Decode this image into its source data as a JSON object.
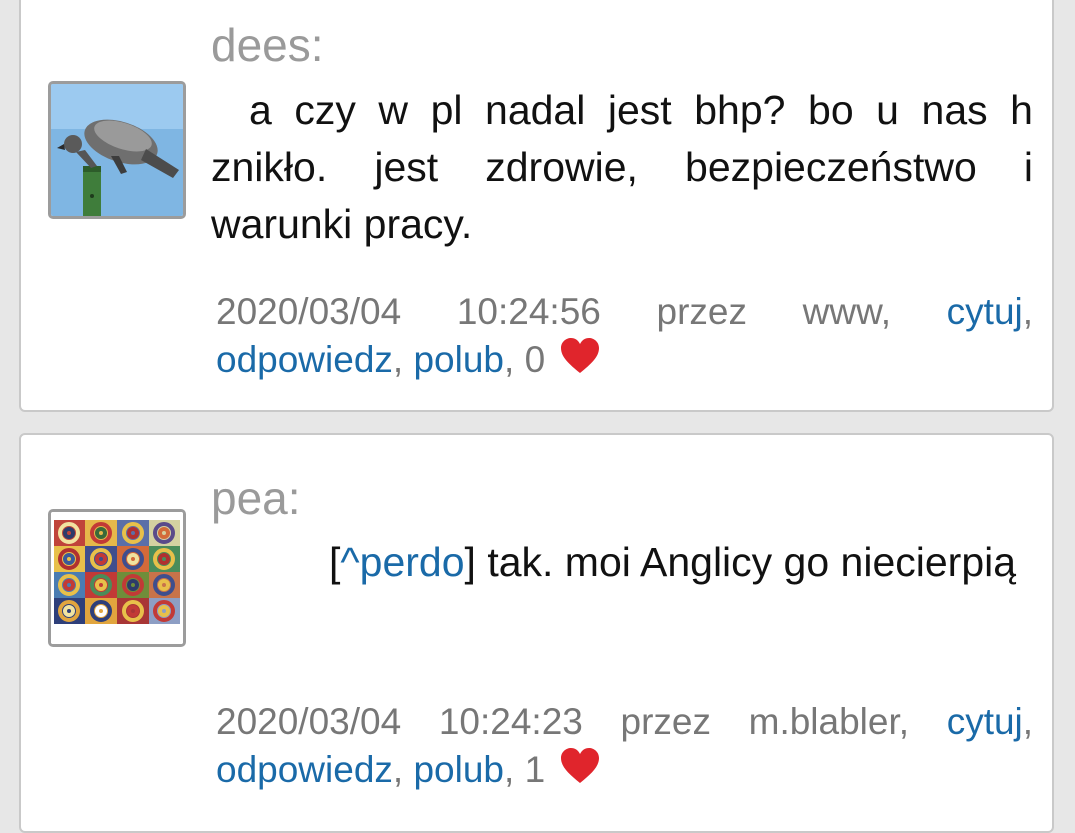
{
  "posts": [
    {
      "author": "dees:",
      "avatar_icon": "pigeon-photo-icon",
      "text": "a czy w pl nadal jest bhp? bo u nas h znikło. jest zdrowie, bezpieczeństwo i warunki pracy.",
      "meta": {
        "date": "2020/03/04",
        "time": "10:24:56",
        "via_label": "przez",
        "user": "www,",
        "quote_label": "cytuj",
        "reply_label": "odpowiedz",
        "like_label": "polub",
        "like_count": "0"
      }
    },
    {
      "author": "pea:",
      "avatar_icon": "kandinsky-circles-icon",
      "reply_to": "^perdo",
      "text": "tak. moi Anglicy go niecierpią",
      "meta": {
        "date": "2020/03/04",
        "time": "10:24:23",
        "via_label": "przez",
        "user": "m.blabler,",
        "quote_label": "cytuj",
        "reply_label": "odpowiedz",
        "like_label": "polub",
        "like_count": "1"
      }
    }
  ],
  "colors": {
    "link": "#1a6aa8",
    "heart": "#e0252c",
    "author": "#9a9a9a",
    "meta": "#777777"
  }
}
